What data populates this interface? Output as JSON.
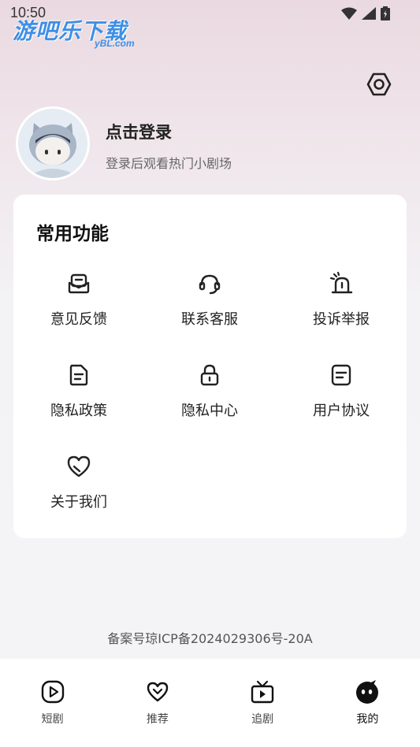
{
  "status": {
    "time": "10:50"
  },
  "watermark": {
    "main": "游吧乐下载",
    "sub": "yBL.com"
  },
  "profile": {
    "name": "点击登录",
    "subtitle": "登录后观看热门小剧场"
  },
  "card": {
    "title": "常用功能",
    "items": [
      {
        "label": "意见反馈",
        "icon": "feedback-icon"
      },
      {
        "label": "联系客服",
        "icon": "headset-icon"
      },
      {
        "label": "投诉举报",
        "icon": "alarm-icon"
      },
      {
        "label": "隐私政策",
        "icon": "document-icon"
      },
      {
        "label": "隐私中心",
        "icon": "lock-icon"
      },
      {
        "label": "用户协议",
        "icon": "agreement-icon"
      },
      {
        "label": "关于我们",
        "icon": "heart-icon"
      }
    ]
  },
  "footer": {
    "icp": "备案号琼ICP备2024029306号-20A"
  },
  "tabbar": {
    "tabs": [
      {
        "label": "短剧",
        "icon": "play-icon"
      },
      {
        "label": "推荐",
        "icon": "heart-chevron-icon"
      },
      {
        "label": "追剧",
        "icon": "tv-icon"
      },
      {
        "label": "我的",
        "icon": "profile-face-icon"
      }
    ],
    "active_index": 3
  }
}
